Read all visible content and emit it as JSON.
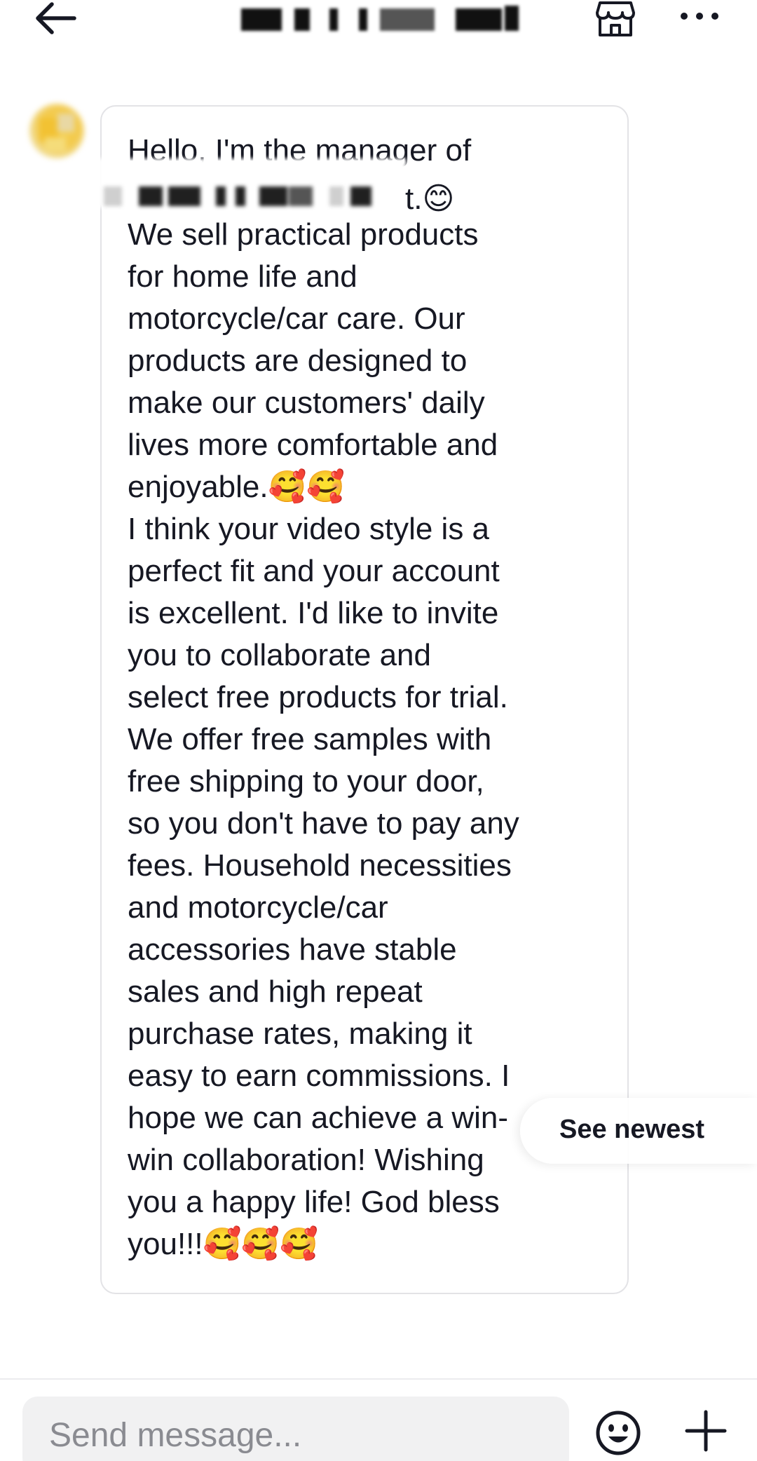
{
  "header": {
    "title": "",
    "back_icon": "back-arrow-icon",
    "shop_icon": "shop-icon",
    "more_icon": "more-dots-icon"
  },
  "message": {
    "text_lines": [
      "Hello, I'm the manager of",
      "",
      "We sell practical products",
      "for home life and",
      "motorcycle/car care. Our",
      "products are designed to",
      "make our customers' daily",
      "lives more comfortable and",
      "enjoyable.🥰🥰",
      "I think your video style is a",
      "perfect fit and your account",
      "is excellent. I'd like to invite",
      "you to collaborate and",
      "select free products for trial.",
      "We offer free samples with",
      "free shipping to your door,",
      "so you don't have to pay any",
      "fees. Household necessities",
      "and motorcycle/car",
      "accessories have stable",
      "sales and high repeat",
      "purchase rates, making it",
      "easy to earn commissions. I",
      "hope we can achieve a win-",
      "win collaboration! Wishing",
      "you a happy life! God bless",
      "you!!!🥰🥰🥰"
    ],
    "redacted_tail": "t.😊"
  },
  "see_newest": {
    "label": "See newest"
  },
  "composer": {
    "placeholder": "Send message...",
    "value": "",
    "emoji_icon": "emoji-face-icon",
    "plus_icon": "plus-icon"
  }
}
